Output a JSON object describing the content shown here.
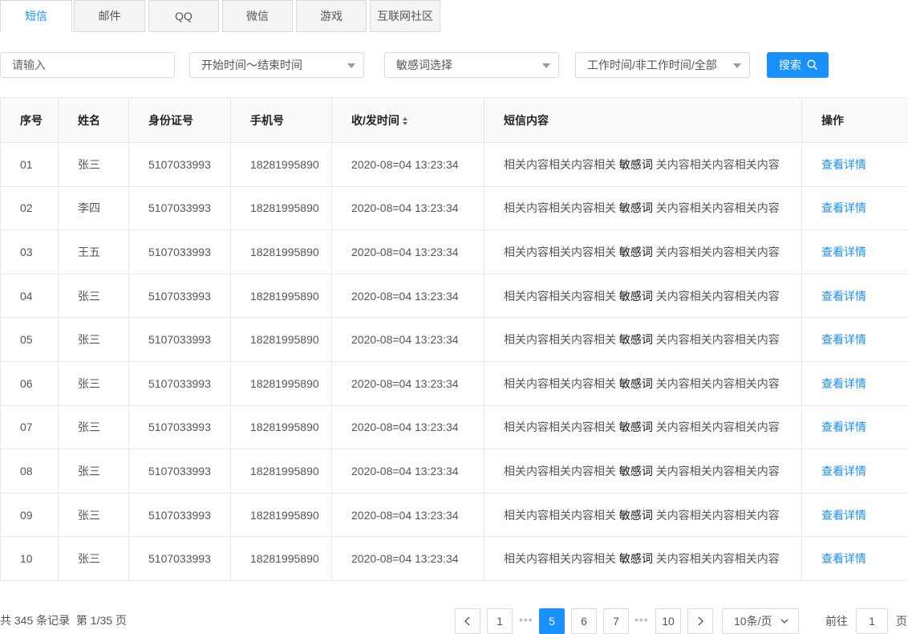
{
  "tabs": [
    "短信",
    "邮件",
    "QQ",
    "微信",
    "游戏",
    "互联网社区"
  ],
  "filters": {
    "keyword_placeholder": "请输入",
    "time_range": "开始时间～结束时间",
    "sensitive_word": "敏感词选择",
    "work_time": "工作时间/非工作时间/全部",
    "search_label": "搜索"
  },
  "table": {
    "headers": [
      "序号",
      "姓名",
      "身份证号",
      "手机号",
      "收/发时间",
      "短信内容",
      "操作"
    ],
    "rows": [
      {
        "no": "01",
        "name": "张三",
        "id": "5107033993",
        "phone": "18281995890",
        "time": "2020-08=04 13:23:34",
        "pre": "相关内容相关内容相关",
        "kw": "敏感词",
        "post": "关内容相关内容相关内容",
        "action": "查看详情"
      },
      {
        "no": "02",
        "name": "李四",
        "id": "5107033993",
        "phone": "18281995890",
        "time": "2020-08=04 13:23:34",
        "pre": "相关内容相关内容相关",
        "kw": "敏感词",
        "post": "关内容相关内容相关内容",
        "action": "查看详情"
      },
      {
        "no": "03",
        "name": "王五",
        "id": "5107033993",
        "phone": "18281995890",
        "time": "2020-08=04 13:23:34",
        "pre": "相关内容相关内容相关",
        "kw": "敏感词",
        "post": "关内容相关内容相关内容",
        "action": "查看详情"
      },
      {
        "no": "04",
        "name": "张三",
        "id": "5107033993",
        "phone": "18281995890",
        "time": "2020-08=04 13:23:34",
        "pre": "相关内容相关内容相关",
        "kw": "敏感词",
        "post": "关内容相关内容相关内容",
        "action": "查看详情"
      },
      {
        "no": "05",
        "name": "张三",
        "id": "5107033993",
        "phone": "18281995890",
        "time": "2020-08=04 13:23:34",
        "pre": "相关内容相关内容相关",
        "kw": "敏感词",
        "post": "关内容相关内容相关内容",
        "action": "查看详情"
      },
      {
        "no": "06",
        "name": "张三",
        "id": "5107033993",
        "phone": "18281995890",
        "time": "2020-08=04 13:23:34",
        "pre": "相关内容相关内容相关",
        "kw": "敏感词",
        "post": "关内容相关内容相关内容",
        "action": "查看详情"
      },
      {
        "no": "07",
        "name": "张三",
        "id": "5107033993",
        "phone": "18281995890",
        "time": "2020-08=04 13:23:34",
        "pre": "相关内容相关内容相关",
        "kw": "敏感词",
        "post": "关内容相关内容相关内容",
        "action": "查看详情"
      },
      {
        "no": "08",
        "name": "张三",
        "id": "5107033993",
        "phone": "18281995890",
        "time": "2020-08=04 13:23:34",
        "pre": "相关内容相关内容相关",
        "kw": "敏感词",
        "post": "关内容相关内容相关内容",
        "action": "查看详情"
      },
      {
        "no": "09",
        "name": "张三",
        "id": "5107033993",
        "phone": "18281995890",
        "time": "2020-08=04 13:23:34",
        "pre": "相关内容相关内容相关",
        "kw": "敏感词",
        "post": "关内容相关内容相关内容",
        "action": "查看详情"
      },
      {
        "no": "10",
        "name": "张三",
        "id": "5107033993",
        "phone": "18281995890",
        "time": "2020-08=04 13:23:34",
        "pre": "相关内容相关内容相关",
        "kw": "敏感词",
        "post": "关内容相关内容相关内容",
        "action": "查看详情"
      }
    ]
  },
  "footer": {
    "summary": "共 345 条记录  第 1/35 页",
    "pages": [
      "1",
      "5",
      "6",
      "7",
      "10"
    ],
    "current_page": "5",
    "ellipsis": "•••",
    "page_size": "10条/页",
    "goto_label": "前往",
    "goto_value": "1",
    "goto_suffix": "页"
  },
  "colors": {
    "accent": "#1890ff",
    "border": "#d9d9d9",
    "header_bg": "#fafafa"
  }
}
